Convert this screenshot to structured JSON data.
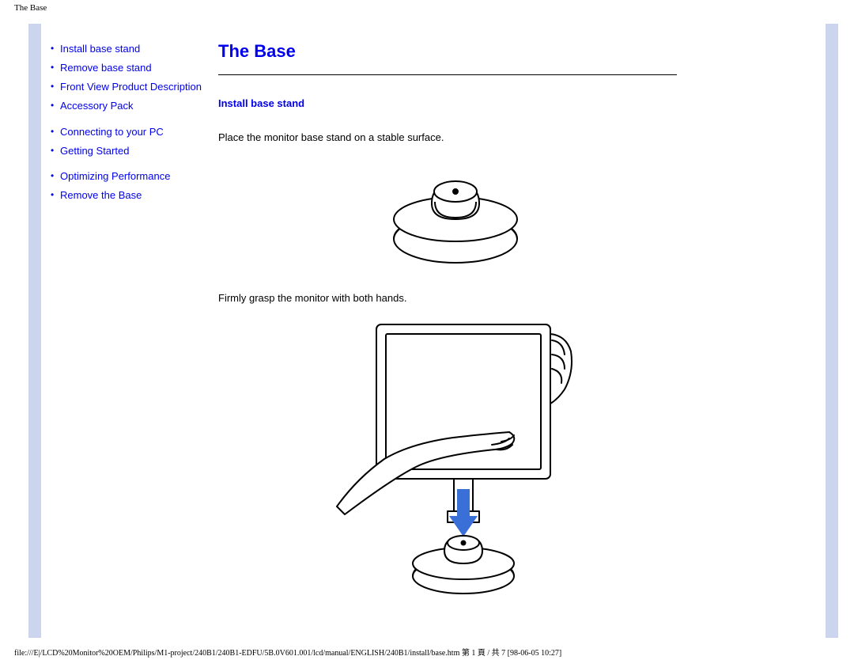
{
  "header": {
    "title": "The Base"
  },
  "sidebar": {
    "group1": [
      {
        "label": "Install base stand"
      },
      {
        "label": "Remove base stand"
      },
      {
        "label": "Front View Product Description"
      },
      {
        "label": "Accessory Pack"
      }
    ],
    "group2": [
      {
        "label": "Connecting to your PC"
      },
      {
        "label": "Getting Started"
      }
    ],
    "group3": [
      {
        "label": "Optimizing Performance"
      },
      {
        "label": "Remove the Base"
      }
    ]
  },
  "main": {
    "title": "The Base",
    "section_heading": "Install base stand",
    "step1": "Place the monitor base stand on a stable surface.",
    "step2": "Firmly grasp the monitor with both hands."
  },
  "footer": {
    "path": "file:///E|/LCD%20Monitor%20OEM/Philips/M1-project/240B1/240B1-EDFU/5B.0V601.001/lcd/manual/ENGLISH/240B1/install/base.htm 第 1 頁 / 共 7  [98-06-05 10:27]"
  }
}
